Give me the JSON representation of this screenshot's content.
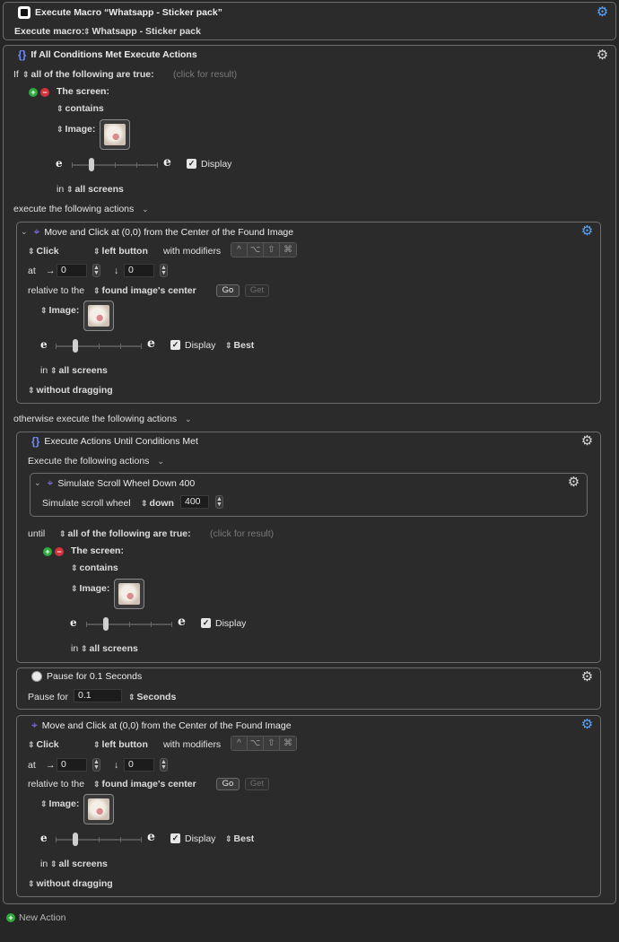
{
  "macro_action": {
    "title": "Execute Macro “Whatsapp - Sticker pack”",
    "label": "Execute macro:",
    "value": "Whatsapp - Sticker pack"
  },
  "if_action": {
    "title": "If All Conditions Met Execute Actions",
    "if_label": "If",
    "condition_mode": "all of the following are true:",
    "click_result": "(click for result)",
    "screen_label": "The screen:",
    "contains": "contains",
    "image_label": "Image:",
    "display_label": "Display",
    "in_label": "in",
    "screens": "all screens",
    "execute_label": "execute the following actions",
    "otherwise_label": "otherwise execute the following actions"
  },
  "click_action_1": {
    "title": "Move and Click at (0,0) from the Center of the Found Image",
    "click_type": "Click",
    "button": "left button",
    "modifiers_label": "with modifiers",
    "modifiers": [
      "^",
      "⌥",
      "⇧",
      "⌘"
    ],
    "at_label": "at",
    "x_arrow": "→",
    "x_value": "0",
    "y_arrow": "↓",
    "y_value": "0",
    "relative_label": "relative to the",
    "relative_value": "found image's center",
    "go_label": "Go",
    "get_label": "Get",
    "image_label": "Image:",
    "display_label": "Display",
    "best_label": "Best",
    "in_label": "in",
    "screens": "all screens",
    "drag_mode": "without dragging"
  },
  "until_action": {
    "title": "Execute Actions Until Conditions Met",
    "execute_label": "Execute the following actions",
    "until_label": "until",
    "condition_mode": "all of the following are true:",
    "click_result": "(click for result)",
    "screen_label": "The screen:",
    "contains": "contains",
    "image_label": "Image:",
    "display_label": "Display",
    "in_label": "in",
    "screens": "all screens"
  },
  "scroll_action": {
    "title": "Simulate Scroll Wheel Down 400",
    "label": "Simulate scroll wheel",
    "direction": "down",
    "amount": "400"
  },
  "pause_action": {
    "title": "Pause for 0.1 Seconds",
    "label": "Pause for",
    "value": "0.1",
    "unit": "Seconds"
  },
  "click_action_2": {
    "title": "Move and Click at (0,0) from the Center of the Found Image",
    "click_type": "Click",
    "button": "left button",
    "modifiers_label": "with modifiers",
    "modifiers": [
      "^",
      "⌥",
      "⇧",
      "⌘"
    ],
    "at_label": "at",
    "x_arrow": "→",
    "x_value": "0",
    "y_arrow": "↓",
    "y_value": "0",
    "relative_label": "relative to the",
    "relative_value": "found image's center",
    "go_label": "Go",
    "get_label": "Get",
    "image_label": "Image:",
    "display_label": "Display",
    "best_label": "Best",
    "in_label": "in",
    "screens": "all screens",
    "drag_mode": "without dragging"
  },
  "footer": {
    "new_action": "New Action"
  },
  "icons": {
    "gear": "gear-icon",
    "macro": "macro-icon",
    "braces": "braces-icon",
    "cursor": "cursor-click-icon",
    "clock": "clock-icon",
    "add": "plus-circle-icon",
    "remove": "minus-circle-icon"
  },
  "colors": {
    "background": "#262626",
    "accent_blue": "#5aa6ff",
    "add_green": "#2eaa3c",
    "remove_red": "#d2333b"
  }
}
